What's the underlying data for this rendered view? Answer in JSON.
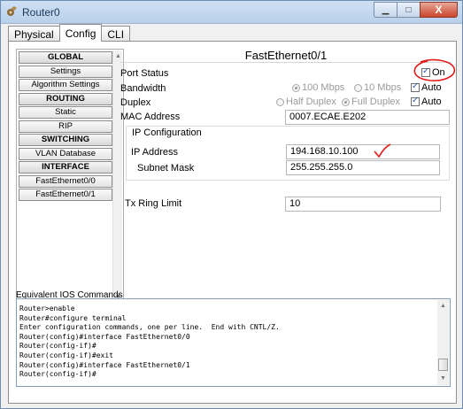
{
  "window": {
    "title": "Router0",
    "minimize_glyph": "▁",
    "maximize_glyph": "□",
    "close_glyph": "X"
  },
  "tabs": [
    {
      "label": "Physical",
      "active": false
    },
    {
      "label": "Config",
      "active": true
    },
    {
      "label": "CLI",
      "active": false
    }
  ],
  "nav": {
    "items": [
      {
        "label": "GLOBAL",
        "header": true
      },
      {
        "label": "Settings",
        "header": false
      },
      {
        "label": "Algorithm Settings",
        "header": false
      },
      {
        "label": "ROUTING",
        "header": true
      },
      {
        "label": "Static",
        "header": false
      },
      {
        "label": "RIP",
        "header": false
      },
      {
        "label": "SWITCHING",
        "header": true
      },
      {
        "label": "VLAN Database",
        "header": false
      },
      {
        "label": "INTERFACE",
        "header": true
      },
      {
        "label": "FastEthernet0/0",
        "header": false
      },
      {
        "label": "FastEthernet0/1",
        "header": false
      }
    ],
    "up_arrow": "▲",
    "down_arrow": "▼"
  },
  "panel": {
    "title": "FastEthernet0/1",
    "port_status": {
      "label": "Port Status",
      "on_label": "On",
      "checked": true
    },
    "bandwidth": {
      "label": "Bandwidth",
      "opt1": "100 Mbps",
      "opt2": "10 Mbps",
      "auto_label": "Auto",
      "auto_checked": true
    },
    "duplex": {
      "label": "Duplex",
      "opt1": "Half Duplex",
      "opt2": "Full Duplex",
      "auto_label": "Auto",
      "auto_checked": true
    },
    "mac": {
      "label": "MAC Address",
      "value": "0007.ECAE.E202"
    },
    "ip_config": {
      "title": "IP Configuration",
      "ip_label": "IP Address",
      "ip_value": "194.168.10.100",
      "mask_label": "Subnet Mask",
      "mask_value": "255.255.255.0"
    },
    "tx": {
      "label": "Tx Ring Limit",
      "value": "10"
    }
  },
  "ios": {
    "label": "Equivalent IOS Commands",
    "text": "Router>enable\nRouter#configure terminal\nEnter configuration commands, one per line.  End with CNTL/Z.\nRouter(config)#interface FastEthernet0/0\nRouter(config-if)#\nRouter(config-if)#exit\nRouter(config)#interface FastEthernet0/1\nRouter(config-if)#",
    "up_arrow": "▲",
    "down_arrow": "▼"
  },
  "colors": {
    "annotation": "#e21b1b",
    "accent": "#2a5ba8"
  }
}
